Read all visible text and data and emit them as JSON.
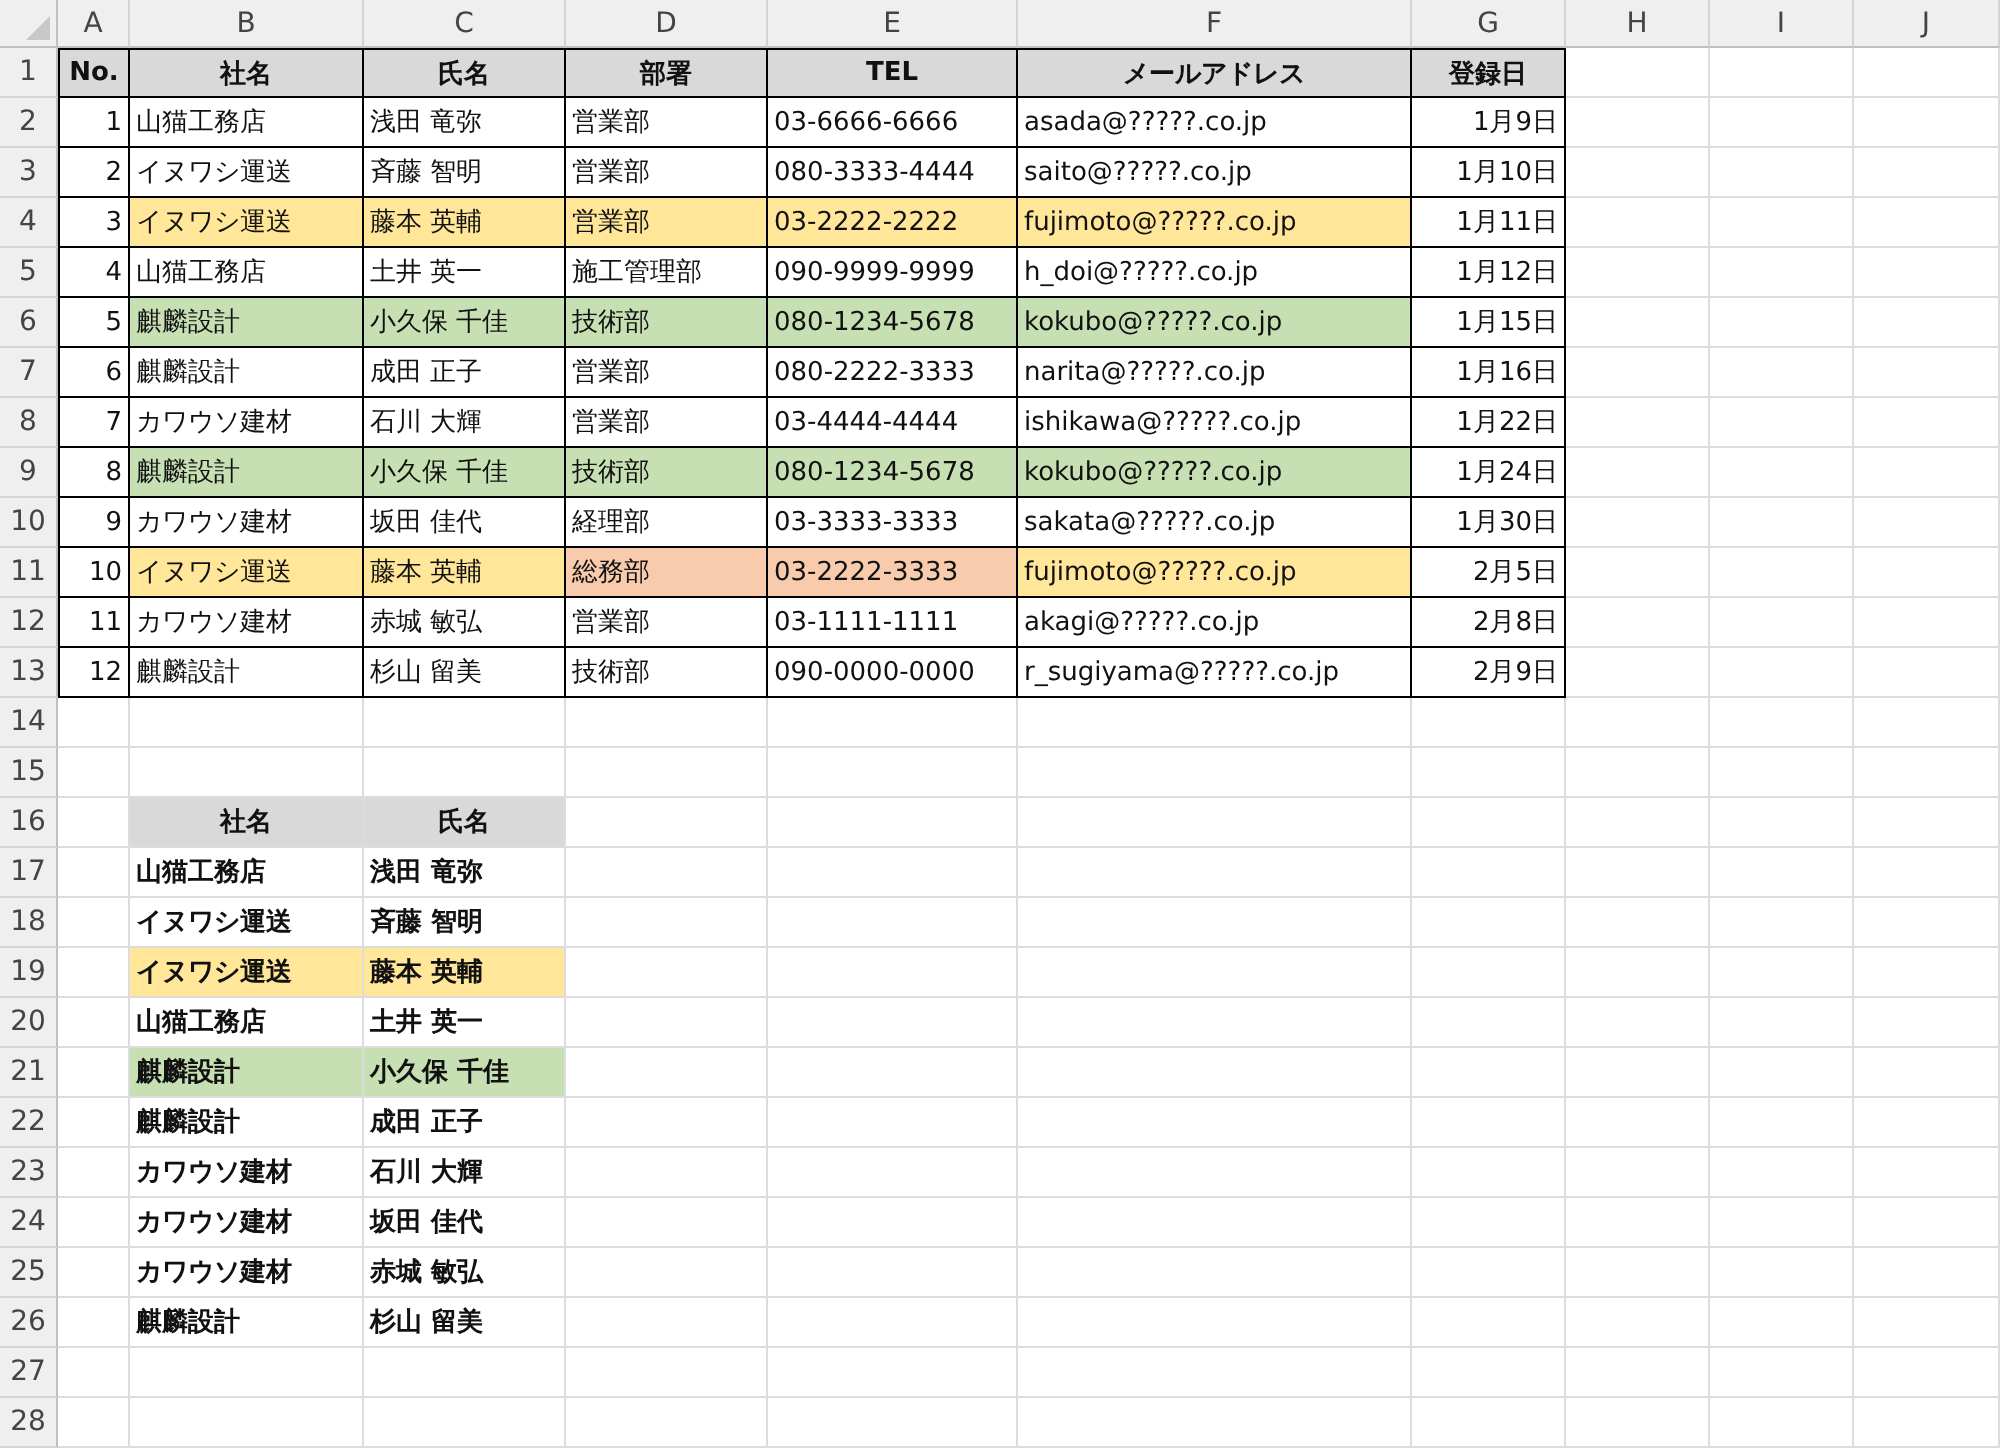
{
  "column_headers": [
    "A",
    "B",
    "C",
    "D",
    "E",
    "F",
    "G",
    "H",
    "I",
    "J"
  ],
  "row_headers": [
    "1",
    "2",
    "3",
    "4",
    "5",
    "6",
    "7",
    "8",
    "9",
    "10",
    "11",
    "12",
    "13",
    "14",
    "15",
    "16",
    "17",
    "18",
    "19",
    "20",
    "21",
    "22",
    "23",
    "24",
    "25",
    "26",
    "27",
    "28"
  ],
  "table": {
    "columns": [
      "No.",
      "社名",
      "氏名",
      "部署",
      "TEL",
      "メールアドレス",
      "登録日"
    ],
    "rows": [
      {
        "cells": [
          {
            "text": "1"
          },
          {
            "text": "山猫工務店"
          },
          {
            "text": "浅田 竜弥"
          },
          {
            "text": "営業部"
          },
          {
            "text": "03-6666-6666"
          },
          {
            "text": "asada@?????.co.jp"
          },
          {
            "text": "1月9日"
          }
        ]
      },
      {
        "cells": [
          {
            "text": "2"
          },
          {
            "text": "イヌワシ運送"
          },
          {
            "text": "斉藤 智明"
          },
          {
            "text": "営業部"
          },
          {
            "text": "080-3333-4444"
          },
          {
            "text": "saito@?????.co.jp"
          },
          {
            "text": "1月10日"
          }
        ]
      },
      {
        "cells": [
          {
            "text": "3"
          },
          {
            "text": "イヌワシ運送",
            "color": "#ffe699"
          },
          {
            "text": "藤本 英輔",
            "color": "#ffe699"
          },
          {
            "text": "営業部",
            "color": "#ffe699"
          },
          {
            "text": "03-2222-2222",
            "color": "#ffe699"
          },
          {
            "text": "fujimoto@?????.co.jp",
            "color": "#ffe699"
          },
          {
            "text": "1月11日"
          }
        ]
      },
      {
        "cells": [
          {
            "text": "4"
          },
          {
            "text": "山猫工務店"
          },
          {
            "text": "土井 英一"
          },
          {
            "text": "施工管理部"
          },
          {
            "text": "090-9999-9999"
          },
          {
            "text": "h_doi@?????.co.jp"
          },
          {
            "text": "1月12日"
          }
        ]
      },
      {
        "cells": [
          {
            "text": "5"
          },
          {
            "text": "麒麟設計",
            "color": "#c6e0b4"
          },
          {
            "text": "小久保 千佳",
            "color": "#c6e0b4"
          },
          {
            "text": "技術部",
            "color": "#c6e0b4"
          },
          {
            "text": "080-1234-5678",
            "color": "#c6e0b4"
          },
          {
            "text": "kokubo@?????.co.jp",
            "color": "#c6e0b4"
          },
          {
            "text": "1月15日"
          }
        ]
      },
      {
        "cells": [
          {
            "text": "6"
          },
          {
            "text": "麒麟設計"
          },
          {
            "text": "成田 正子"
          },
          {
            "text": "営業部"
          },
          {
            "text": "080-2222-3333"
          },
          {
            "text": "narita@?????.co.jp"
          },
          {
            "text": "1月16日"
          }
        ]
      },
      {
        "cells": [
          {
            "text": "7"
          },
          {
            "text": "カワウソ建材"
          },
          {
            "text": "石川 大輝"
          },
          {
            "text": "営業部"
          },
          {
            "text": "03-4444-4444"
          },
          {
            "text": "ishikawa@?????.co.jp"
          },
          {
            "text": "1月22日"
          }
        ]
      },
      {
        "cells": [
          {
            "text": "8"
          },
          {
            "text": "麒麟設計",
            "color": "#c6e0b4"
          },
          {
            "text": "小久保 千佳",
            "color": "#c6e0b4"
          },
          {
            "text": "技術部",
            "color": "#c6e0b4"
          },
          {
            "text": "080-1234-5678",
            "color": "#c6e0b4"
          },
          {
            "text": "kokubo@?????.co.jp",
            "color": "#c6e0b4"
          },
          {
            "text": "1月24日"
          }
        ]
      },
      {
        "cells": [
          {
            "text": "9"
          },
          {
            "text": "カワウソ建材"
          },
          {
            "text": "坂田 佳代"
          },
          {
            "text": "経理部"
          },
          {
            "text": "03-3333-3333"
          },
          {
            "text": "sakata@?????.co.jp"
          },
          {
            "text": "1月30日"
          }
        ]
      },
      {
        "cells": [
          {
            "text": "10"
          },
          {
            "text": "イヌワシ運送",
            "color": "#ffe699"
          },
          {
            "text": "藤本 英輔",
            "color": "#ffe699"
          },
          {
            "text": "総務部",
            "color": "#f8cbad"
          },
          {
            "text": "03-2222-3333",
            "color": "#f8cbad"
          },
          {
            "text": "fujimoto@?????.co.jp",
            "color": "#ffe699"
          },
          {
            "text": "2月5日"
          }
        ]
      },
      {
        "cells": [
          {
            "text": "11"
          },
          {
            "text": "カワウソ建材"
          },
          {
            "text": "赤城 敏弘"
          },
          {
            "text": "営業部"
          },
          {
            "text": "03-1111-1111"
          },
          {
            "text": "akagi@?????.co.jp"
          },
          {
            "text": "2月8日"
          }
        ]
      },
      {
        "cells": [
          {
            "text": "12"
          },
          {
            "text": "麒麟設計"
          },
          {
            "text": "杉山 留美"
          },
          {
            "text": "技術部"
          },
          {
            "text": "090-0000-0000"
          },
          {
            "text": "r_sugiyama@?????.co.jp"
          },
          {
            "text": "2月9日"
          }
        ]
      }
    ]
  },
  "summary": {
    "columns": [
      "社名",
      "氏名"
    ],
    "rows": [
      {
        "cells": [
          {
            "text": "山猫工務店"
          },
          {
            "text": "浅田 竜弥"
          }
        ]
      },
      {
        "cells": [
          {
            "text": "イヌワシ運送"
          },
          {
            "text": "斉藤 智明"
          }
        ]
      },
      {
        "cells": [
          {
            "text": "イヌワシ運送",
            "color": "#ffe699"
          },
          {
            "text": "藤本 英輔",
            "color": "#ffe699"
          }
        ]
      },
      {
        "cells": [
          {
            "text": "山猫工務店"
          },
          {
            "text": "土井 英一"
          }
        ]
      },
      {
        "cells": [
          {
            "text": "麒麟設計",
            "color": "#c6e0b4"
          },
          {
            "text": "小久保 千佳",
            "color": "#c6e0b4"
          }
        ]
      },
      {
        "cells": [
          {
            "text": "麒麟設計"
          },
          {
            "text": "成田 正子"
          }
        ]
      },
      {
        "cells": [
          {
            "text": "カワウソ建材"
          },
          {
            "text": "石川 大輝"
          }
        ]
      },
      {
        "cells": [
          {
            "text": "カワウソ建材"
          },
          {
            "text": "坂田 佳代"
          }
        ]
      },
      {
        "cells": [
          {
            "text": "カワウソ建材"
          },
          {
            "text": "赤城 敏弘"
          }
        ]
      },
      {
        "cells": [
          {
            "text": "麒麟設計"
          },
          {
            "text": "杉山 留美"
          }
        ]
      }
    ]
  }
}
